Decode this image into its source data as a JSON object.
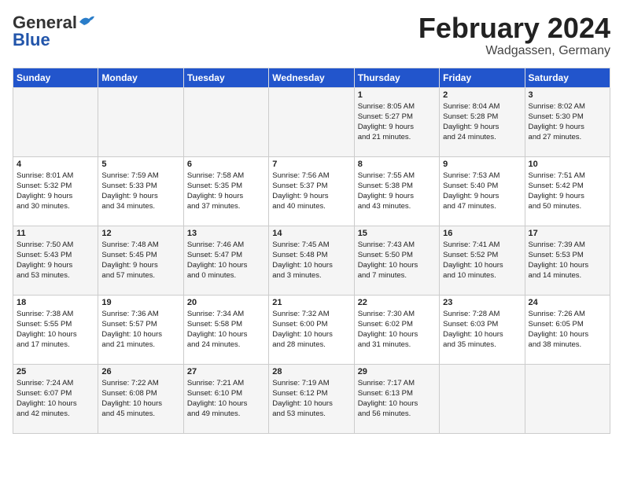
{
  "header": {
    "logo_line1": "General",
    "logo_line2": "Blue",
    "month_title": "February 2024",
    "location": "Wadgassen, Germany"
  },
  "days_of_week": [
    "Sunday",
    "Monday",
    "Tuesday",
    "Wednesday",
    "Thursday",
    "Friday",
    "Saturday"
  ],
  "weeks": [
    [
      {
        "day": "",
        "info": ""
      },
      {
        "day": "",
        "info": ""
      },
      {
        "day": "",
        "info": ""
      },
      {
        "day": "",
        "info": ""
      },
      {
        "day": "1",
        "info": "Sunrise: 8:05 AM\nSunset: 5:27 PM\nDaylight: 9 hours\nand 21 minutes."
      },
      {
        "day": "2",
        "info": "Sunrise: 8:04 AM\nSunset: 5:28 PM\nDaylight: 9 hours\nand 24 minutes."
      },
      {
        "day": "3",
        "info": "Sunrise: 8:02 AM\nSunset: 5:30 PM\nDaylight: 9 hours\nand 27 minutes."
      }
    ],
    [
      {
        "day": "4",
        "info": "Sunrise: 8:01 AM\nSunset: 5:32 PM\nDaylight: 9 hours\nand 30 minutes."
      },
      {
        "day": "5",
        "info": "Sunrise: 7:59 AM\nSunset: 5:33 PM\nDaylight: 9 hours\nand 34 minutes."
      },
      {
        "day": "6",
        "info": "Sunrise: 7:58 AM\nSunset: 5:35 PM\nDaylight: 9 hours\nand 37 minutes."
      },
      {
        "day": "7",
        "info": "Sunrise: 7:56 AM\nSunset: 5:37 PM\nDaylight: 9 hours\nand 40 minutes."
      },
      {
        "day": "8",
        "info": "Sunrise: 7:55 AM\nSunset: 5:38 PM\nDaylight: 9 hours\nand 43 minutes."
      },
      {
        "day": "9",
        "info": "Sunrise: 7:53 AM\nSunset: 5:40 PM\nDaylight: 9 hours\nand 47 minutes."
      },
      {
        "day": "10",
        "info": "Sunrise: 7:51 AM\nSunset: 5:42 PM\nDaylight: 9 hours\nand 50 minutes."
      }
    ],
    [
      {
        "day": "11",
        "info": "Sunrise: 7:50 AM\nSunset: 5:43 PM\nDaylight: 9 hours\nand 53 minutes."
      },
      {
        "day": "12",
        "info": "Sunrise: 7:48 AM\nSunset: 5:45 PM\nDaylight: 9 hours\nand 57 minutes."
      },
      {
        "day": "13",
        "info": "Sunrise: 7:46 AM\nSunset: 5:47 PM\nDaylight: 10 hours\nand 0 minutes."
      },
      {
        "day": "14",
        "info": "Sunrise: 7:45 AM\nSunset: 5:48 PM\nDaylight: 10 hours\nand 3 minutes."
      },
      {
        "day": "15",
        "info": "Sunrise: 7:43 AM\nSunset: 5:50 PM\nDaylight: 10 hours\nand 7 minutes."
      },
      {
        "day": "16",
        "info": "Sunrise: 7:41 AM\nSunset: 5:52 PM\nDaylight: 10 hours\nand 10 minutes."
      },
      {
        "day": "17",
        "info": "Sunrise: 7:39 AM\nSunset: 5:53 PM\nDaylight: 10 hours\nand 14 minutes."
      }
    ],
    [
      {
        "day": "18",
        "info": "Sunrise: 7:38 AM\nSunset: 5:55 PM\nDaylight: 10 hours\nand 17 minutes."
      },
      {
        "day": "19",
        "info": "Sunrise: 7:36 AM\nSunset: 5:57 PM\nDaylight: 10 hours\nand 21 minutes."
      },
      {
        "day": "20",
        "info": "Sunrise: 7:34 AM\nSunset: 5:58 PM\nDaylight: 10 hours\nand 24 minutes."
      },
      {
        "day": "21",
        "info": "Sunrise: 7:32 AM\nSunset: 6:00 PM\nDaylight: 10 hours\nand 28 minutes."
      },
      {
        "day": "22",
        "info": "Sunrise: 7:30 AM\nSunset: 6:02 PM\nDaylight: 10 hours\nand 31 minutes."
      },
      {
        "day": "23",
        "info": "Sunrise: 7:28 AM\nSunset: 6:03 PM\nDaylight: 10 hours\nand 35 minutes."
      },
      {
        "day": "24",
        "info": "Sunrise: 7:26 AM\nSunset: 6:05 PM\nDaylight: 10 hours\nand 38 minutes."
      }
    ],
    [
      {
        "day": "25",
        "info": "Sunrise: 7:24 AM\nSunset: 6:07 PM\nDaylight: 10 hours\nand 42 minutes."
      },
      {
        "day": "26",
        "info": "Sunrise: 7:22 AM\nSunset: 6:08 PM\nDaylight: 10 hours\nand 45 minutes."
      },
      {
        "day": "27",
        "info": "Sunrise: 7:21 AM\nSunset: 6:10 PM\nDaylight: 10 hours\nand 49 minutes."
      },
      {
        "day": "28",
        "info": "Sunrise: 7:19 AM\nSunset: 6:12 PM\nDaylight: 10 hours\nand 53 minutes."
      },
      {
        "day": "29",
        "info": "Sunrise: 7:17 AM\nSunset: 6:13 PM\nDaylight: 10 hours\nand 56 minutes."
      },
      {
        "day": "",
        "info": ""
      },
      {
        "day": "",
        "info": ""
      }
    ]
  ]
}
